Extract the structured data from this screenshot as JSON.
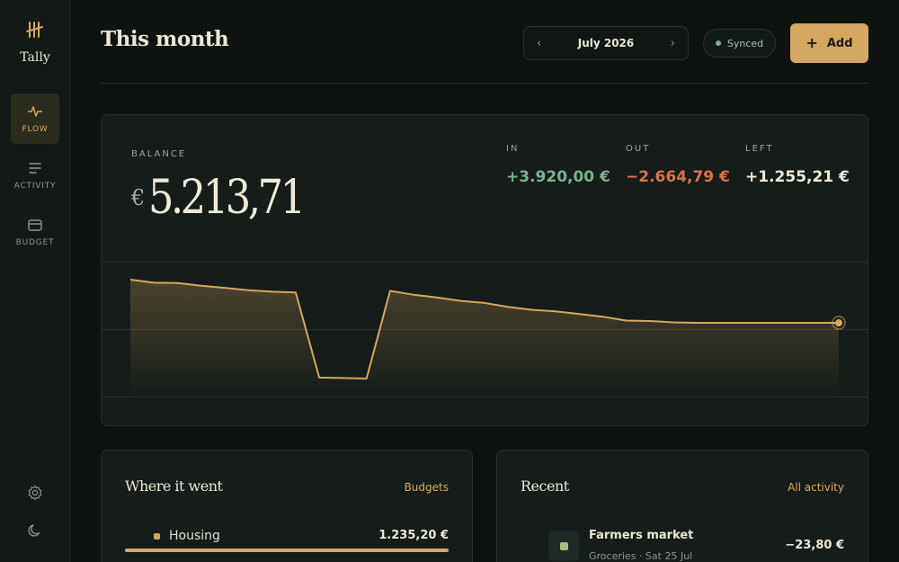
{
  "app": {
    "name": "Tally"
  },
  "sidebar": {
    "items": [
      {
        "label": "FLOW",
        "icon": "pulse-icon",
        "active": true
      },
      {
        "label": "ACTIVITY",
        "icon": "list-icon",
        "active": false
      },
      {
        "label": "BUDGET",
        "icon": "wallet-icon",
        "active": false
      }
    ],
    "bottom_icons": [
      "gear-icon",
      "moon-icon"
    ]
  },
  "header": {
    "title": "This month",
    "month": "July 2026",
    "sync_status": "Synced",
    "add_label": "Add"
  },
  "balance": {
    "label": "BALANCE",
    "currency": "€",
    "amount": "5.213,71",
    "in_label": "IN",
    "in_value": "+3.920,00 €",
    "out_label": "OUT",
    "out_value": "−2.664,79 €",
    "left_label": "LEFT",
    "left_value": "+1.255,21 €"
  },
  "chart_data": {
    "type": "area",
    "x": [
      1,
      2,
      3,
      4,
      5,
      6,
      7,
      8,
      9,
      10,
      11,
      12,
      13,
      14,
      15,
      16,
      17,
      18,
      19,
      20,
      21,
      22,
      23,
      24,
      25,
      26,
      27,
      28,
      29,
      30,
      31
    ],
    "series": [
      {
        "values": [
          5290,
          5170,
          5160,
          5050,
          4970,
          4880,
          4820,
          4790,
          1460,
          1440,
          1420,
          4850,
          4700,
          4590,
          4460,
          4380,
          4220,
          4110,
          4050,
          3950,
          3840,
          3690,
          3670,
          3620,
          3600,
          3600,
          3600,
          3600,
          3600,
          3600,
          3600
        ]
      }
    ],
    "grid": true,
    "colors": {
      "line": "#d5a860",
      "fill": "#d5a860"
    }
  },
  "spending": {
    "title": "Where it went",
    "link": "Budgets",
    "categories": [
      {
        "name": "Housing",
        "amount": "1.235,20 €",
        "share": 1.0
      }
    ]
  },
  "recent": {
    "title": "Recent",
    "link": "All activity",
    "transactions": [
      {
        "name": "Farmers market",
        "meta": "Groceries · Sat 25 Jul",
        "amount": "−23,80 €"
      }
    ]
  },
  "colors": {
    "accent": "#d5a860",
    "income": "#7fb190",
    "expense": "#d9734f",
    "background": "#0e1311"
  }
}
